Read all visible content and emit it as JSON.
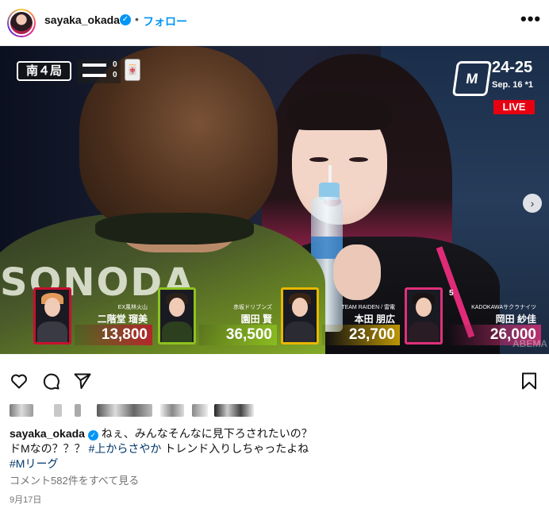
{
  "header": {
    "username": "sayaka_okada",
    "verified_mark": "✓",
    "separator": "•",
    "follow_label": "フォロー",
    "more_label": "•••"
  },
  "media": {
    "round": "南４局",
    "honba_mini": [
      "0",
      "0"
    ],
    "logo_text": "M",
    "season": "24-25",
    "date": "Sep. 16",
    "game_no": "1",
    "live": "LIVE",
    "jersey_text": "SONODA",
    "wind_count": "5",
    "watermark": "ABEMA",
    "next_icon": "chevron-right-icon",
    "next_glyph": "›",
    "players": [
      {
        "team": "EX風林火山",
        "name": "二階堂 瑠美",
        "score": "13,800",
        "accent": "#c8102e"
      },
      {
        "team": "赤坂ドリブンズ",
        "name": "園田 賢",
        "score": "36,500",
        "accent": "#8dc21f"
      },
      {
        "team": "TEAM RAIDEN / 雷電",
        "name": "本田 朋広",
        "score": "23,700",
        "accent": "#e8b800"
      },
      {
        "team": "KADOKAWAサクラナイツ",
        "name": "岡田 紗佳",
        "score": "26,000",
        "accent": "#e0307a"
      }
    ]
  },
  "actions": {
    "like_icon": "heart-icon",
    "comment_icon": "comment-icon",
    "share_icon": "send-icon",
    "save_icon": "bookmark-icon"
  },
  "caption": {
    "username": "sayaka_okada",
    "verified_mark": "✓",
    "text1": " ねぇ、みんなそんなに見下ろされたいの？",
    "text2": "ドMなの？？？ ",
    "tag1": "#上からさやか",
    "text3": " トレンド入りしちゃったよね",
    "tag2": "#Mリーグ"
  },
  "comments_link": "コメント582件をすべて見る",
  "post_date": "9月17日",
  "colors": {
    "link_blue": "#0095f6",
    "hashtag": "#00376b",
    "live_red": "#e60012"
  }
}
